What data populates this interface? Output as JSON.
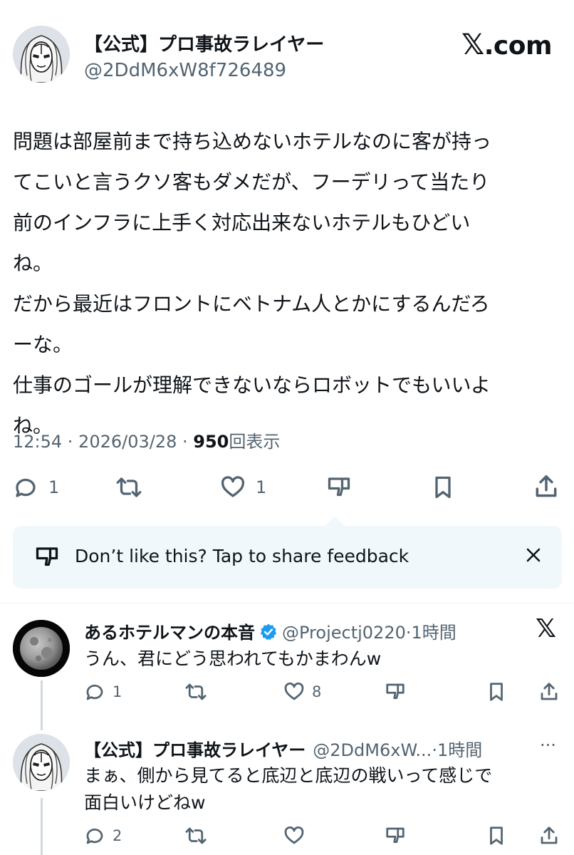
{
  "main_tweet": {
    "author_name": "【公式】プロ事故ラレイヤー",
    "author_handle": "@2DdM6xW8f726489",
    "brand_x": "𝕏",
    "brand_domain": ".com",
    "text": "問題は部屋前まで持ち込めないホテルなのに客が持っ\nてこいと言うクソ客もダメだが、フーデリって当たり\n前のインフラに上手く対応出来ないホテルもひどい\nね。\nだから最近はフロントにベトナム人とかにするんだろ\nーな。\n仕事のゴールが理解できないならロボットでもいいよ\nね。",
    "time": "12:54 · 2026/03/28 · ",
    "views": "950",
    "views_label": "回表示",
    "reply_count": "1",
    "like_count": "1",
    "icons": [
      "reply-icon",
      "retweet-icon",
      "like-icon",
      "dislike-icon",
      "bookmark-icon",
      "share-icon"
    ]
  },
  "feedback": {
    "text": "Don’t like this? Tap to share feedback",
    "close": "✕"
  },
  "replies": [
    {
      "author_name": "あるホテルマンの本音",
      "verified": true,
      "handle": "@Projectj0220",
      "time": "·1時間",
      "text": "うん、君にどう思われてもかまわんw",
      "reply_count": "1",
      "like_count": "8"
    },
    {
      "author_name": "【公式】プロ事故ラレイヤー",
      "handle": "@2DdM6xW...",
      "time": "·1時間",
      "more": "···",
      "text": "まぁ、側から見てると底辺と底辺の戦いって感じで\n面白いけどねw",
      "reply_count": "2",
      "like_count": ""
    }
  ],
  "colors": {
    "text": "#0f1419",
    "secondary": "#536471",
    "feedback_bg": "#f0f8fc",
    "verified": "#1d9bf0"
  }
}
